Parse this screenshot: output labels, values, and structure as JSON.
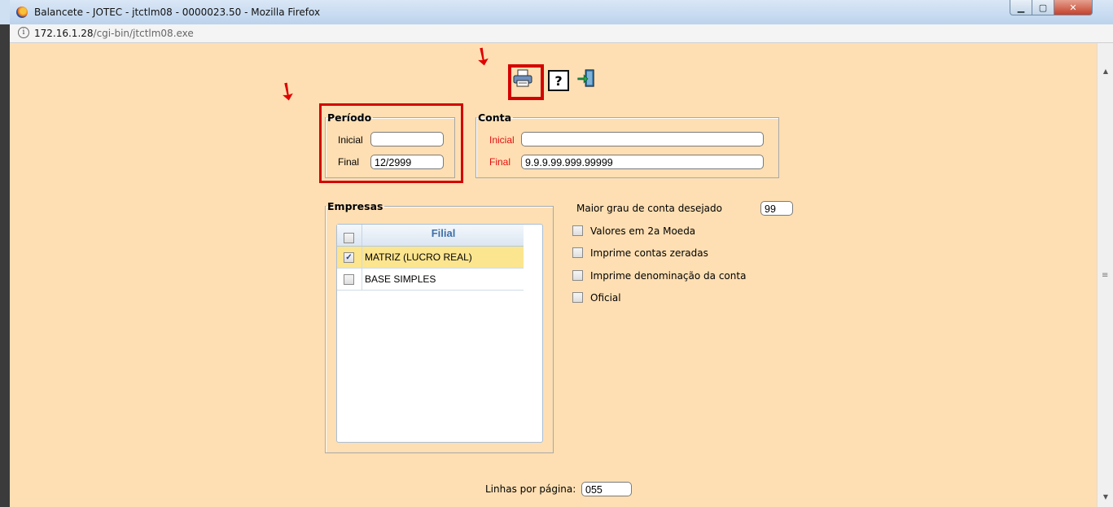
{
  "window": {
    "title": "Balancete - JOTEC - jtctlm08 - 0000023.50 - Mozilla Firefox",
    "url_host": "172.16.1.28",
    "url_path": "/cgi-bin/jtctlm08.exe"
  },
  "toolbar": {
    "print_icon": "printer-icon",
    "help_icon": "help-icon",
    "help_glyph": "?",
    "exit_icon": "exit-icon"
  },
  "periodo": {
    "legend": "Período",
    "inicial_label": "Inicial",
    "inicial_value": "",
    "final_label": "Final",
    "final_value": "12/2999"
  },
  "conta": {
    "legend": "Conta",
    "inicial_label": "Inicial",
    "inicial_value": "",
    "final_label": "Final",
    "final_value": "9.9.9.99.999.99999"
  },
  "empresas": {
    "legend": "Empresas",
    "column_header": "Filial",
    "rows": [
      {
        "name": "MATRIZ (LUCRO REAL)",
        "checked": true
      },
      {
        "name": "BASE SIMPLES",
        "checked": false
      }
    ]
  },
  "options": {
    "grau_label": "Maior grau de conta desejado",
    "grau_value": "99",
    "checkboxes": [
      {
        "label": "Valores em 2a Moeda",
        "checked": false
      },
      {
        "label": "Imprime contas zeradas",
        "checked": false
      },
      {
        "label": "Imprime denominação da conta",
        "checked": false
      },
      {
        "label": "Oficial",
        "checked": false
      }
    ]
  },
  "linhas": {
    "label": "Linhas por página:",
    "value": "055"
  },
  "colors": {
    "page_background": "#fedfb3",
    "highlight": "#d40000",
    "required_label": "#e01010",
    "grid_header_text": "#3e6fa8",
    "selected_row": "#fce58f"
  }
}
